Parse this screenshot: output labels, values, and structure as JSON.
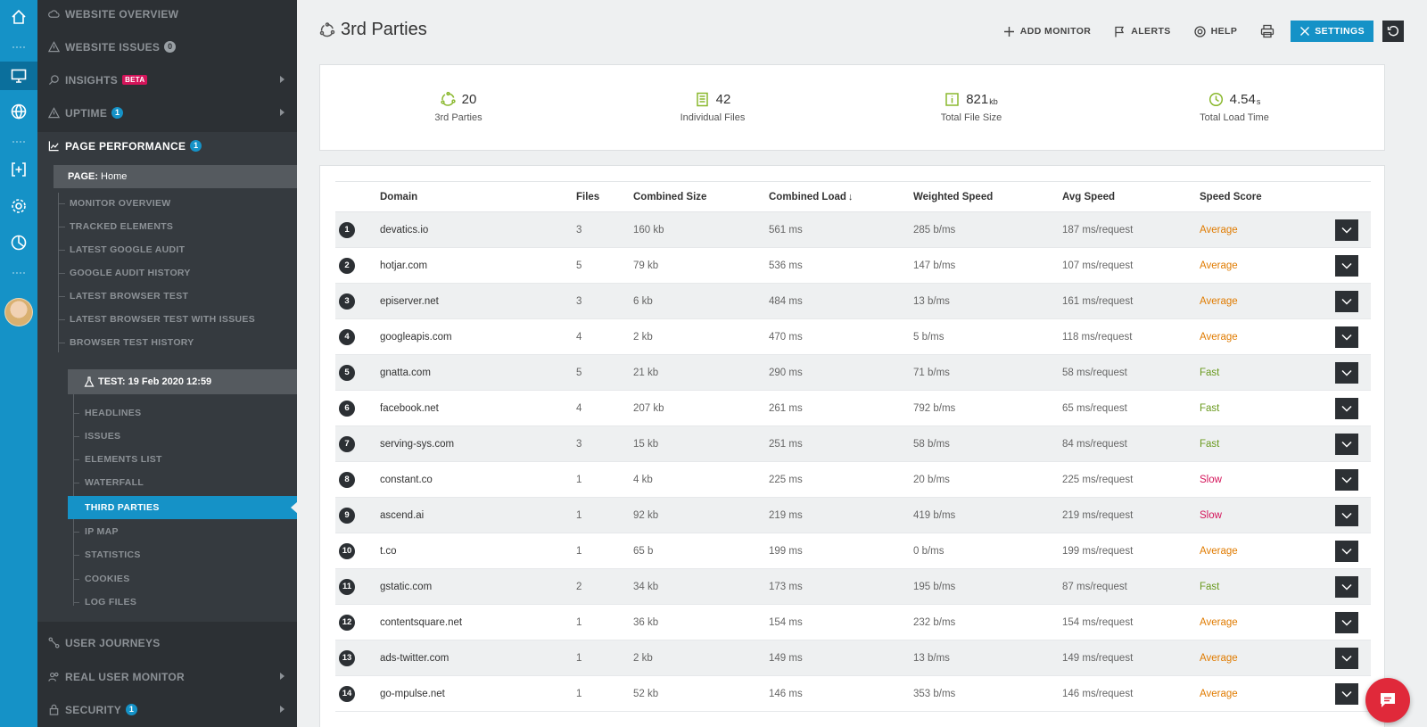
{
  "sidebar": {
    "website_overview": "WEBSITE OVERVIEW",
    "website_issues": "WEBSITE ISSUES",
    "website_issues_count": "0",
    "insights": "INSIGHTS",
    "insights_tag": "BETA",
    "uptime": "UPTIME",
    "uptime_count": "1",
    "page_performance": "PAGE PERFORMANCE",
    "page_performance_count": "1",
    "page_label": "PAGE:",
    "page_name": "Home",
    "monitor_items": [
      "MONITOR OVERVIEW",
      "TRACKED ELEMENTS",
      "LATEST GOOGLE AUDIT",
      "GOOGLE AUDIT HISTORY",
      "LATEST BROWSER TEST",
      "LATEST BROWSER TEST WITH ISSUES",
      "BROWSER TEST HISTORY"
    ],
    "test_label": "TEST: 19 Feb 2020 12:59",
    "test_items": [
      "HEADLINES",
      "ISSUES",
      "ELEMENTS LIST",
      "WATERFALL",
      "THIRD PARTIES",
      "IP MAP",
      "STATISTICS",
      "COOKIES",
      "LOG FILES"
    ],
    "user_journeys": "USER JOURNEYS",
    "real_user_monitor": "REAL USER MONITOR",
    "security": "SECURITY",
    "security_count": "1"
  },
  "header": {
    "title": "3rd Parties",
    "add_monitor": "ADD MONITOR",
    "alerts": "ALERTS",
    "help": "HELP",
    "settings": "SETTINGS"
  },
  "stats": [
    {
      "value": "20",
      "unit": "",
      "label": "3rd Parties"
    },
    {
      "value": "42",
      "unit": "",
      "label": "Individual Files"
    },
    {
      "value": "821",
      "unit": "kb",
      "label": "Total File Size"
    },
    {
      "value": "4.54",
      "unit": "s",
      "label": "Total Load Time"
    }
  ],
  "table": {
    "headers": [
      "Domain",
      "Files",
      "Combined Size",
      "Combined Load",
      "Weighted Speed",
      "Avg Speed",
      "Speed Score"
    ],
    "rows": [
      {
        "n": "1",
        "domain": "devatics.io",
        "files": "3",
        "size": "160 kb",
        "load": "561 ms",
        "weighted": "285 b/ms",
        "avg": "187 ms/request",
        "score": "Average"
      },
      {
        "n": "2",
        "domain": "hotjar.com",
        "files": "5",
        "size": "79 kb",
        "load": "536 ms",
        "weighted": "147 b/ms",
        "avg": "107 ms/request",
        "score": "Average"
      },
      {
        "n": "3",
        "domain": "episerver.net",
        "files": "3",
        "size": "6 kb",
        "load": "484 ms",
        "weighted": "13 b/ms",
        "avg": "161 ms/request",
        "score": "Average"
      },
      {
        "n": "4",
        "domain": "googleapis.com",
        "files": "4",
        "size": "2 kb",
        "load": "470 ms",
        "weighted": "5 b/ms",
        "avg": "118 ms/request",
        "score": "Average"
      },
      {
        "n": "5",
        "domain": "gnatta.com",
        "files": "5",
        "size": "21 kb",
        "load": "290 ms",
        "weighted": "71 b/ms",
        "avg": "58 ms/request",
        "score": "Fast"
      },
      {
        "n": "6",
        "domain": "facebook.net",
        "files": "4",
        "size": "207 kb",
        "load": "261 ms",
        "weighted": "792 b/ms",
        "avg": "65 ms/request",
        "score": "Fast"
      },
      {
        "n": "7",
        "domain": "serving-sys.com",
        "files": "3",
        "size": "15 kb",
        "load": "251 ms",
        "weighted": "58 b/ms",
        "avg": "84 ms/request",
        "score": "Fast"
      },
      {
        "n": "8",
        "domain": "constant.co",
        "files": "1",
        "size": "4 kb",
        "load": "225 ms",
        "weighted": "20 b/ms",
        "avg": "225 ms/request",
        "score": "Slow"
      },
      {
        "n": "9",
        "domain": "ascend.ai",
        "files": "1",
        "size": "92 kb",
        "load": "219 ms",
        "weighted": "419 b/ms",
        "avg": "219 ms/request",
        "score": "Slow"
      },
      {
        "n": "10",
        "domain": "t.co",
        "files": "1",
        "size": "65 b",
        "load": "199 ms",
        "weighted": "0 b/ms",
        "avg": "199 ms/request",
        "score": "Average"
      },
      {
        "n": "11",
        "domain": "gstatic.com",
        "files": "2",
        "size": "34 kb",
        "load": "173 ms",
        "weighted": "195 b/ms",
        "avg": "87 ms/request",
        "score": "Fast"
      },
      {
        "n": "12",
        "domain": "contentsquare.net",
        "files": "1",
        "size": "36 kb",
        "load": "154 ms",
        "weighted": "232 b/ms",
        "avg": "154 ms/request",
        "score": "Average"
      },
      {
        "n": "13",
        "domain": "ads-twitter.com",
        "files": "1",
        "size": "2 kb",
        "load": "149 ms",
        "weighted": "13 b/ms",
        "avg": "149 ms/request",
        "score": "Average"
      },
      {
        "n": "14",
        "domain": "go-mpulse.net",
        "files": "1",
        "size": "52 kb",
        "load": "146 ms",
        "weighted": "353 b/ms",
        "avg": "146 ms/request",
        "score": "Average"
      }
    ]
  },
  "colors": {
    "accent": "#1592c7",
    "sidebar": "#2c3034",
    "average": "#e07b00",
    "fast": "#6a9a1f",
    "slow": "#d4145a",
    "chat": "#e0293a"
  }
}
